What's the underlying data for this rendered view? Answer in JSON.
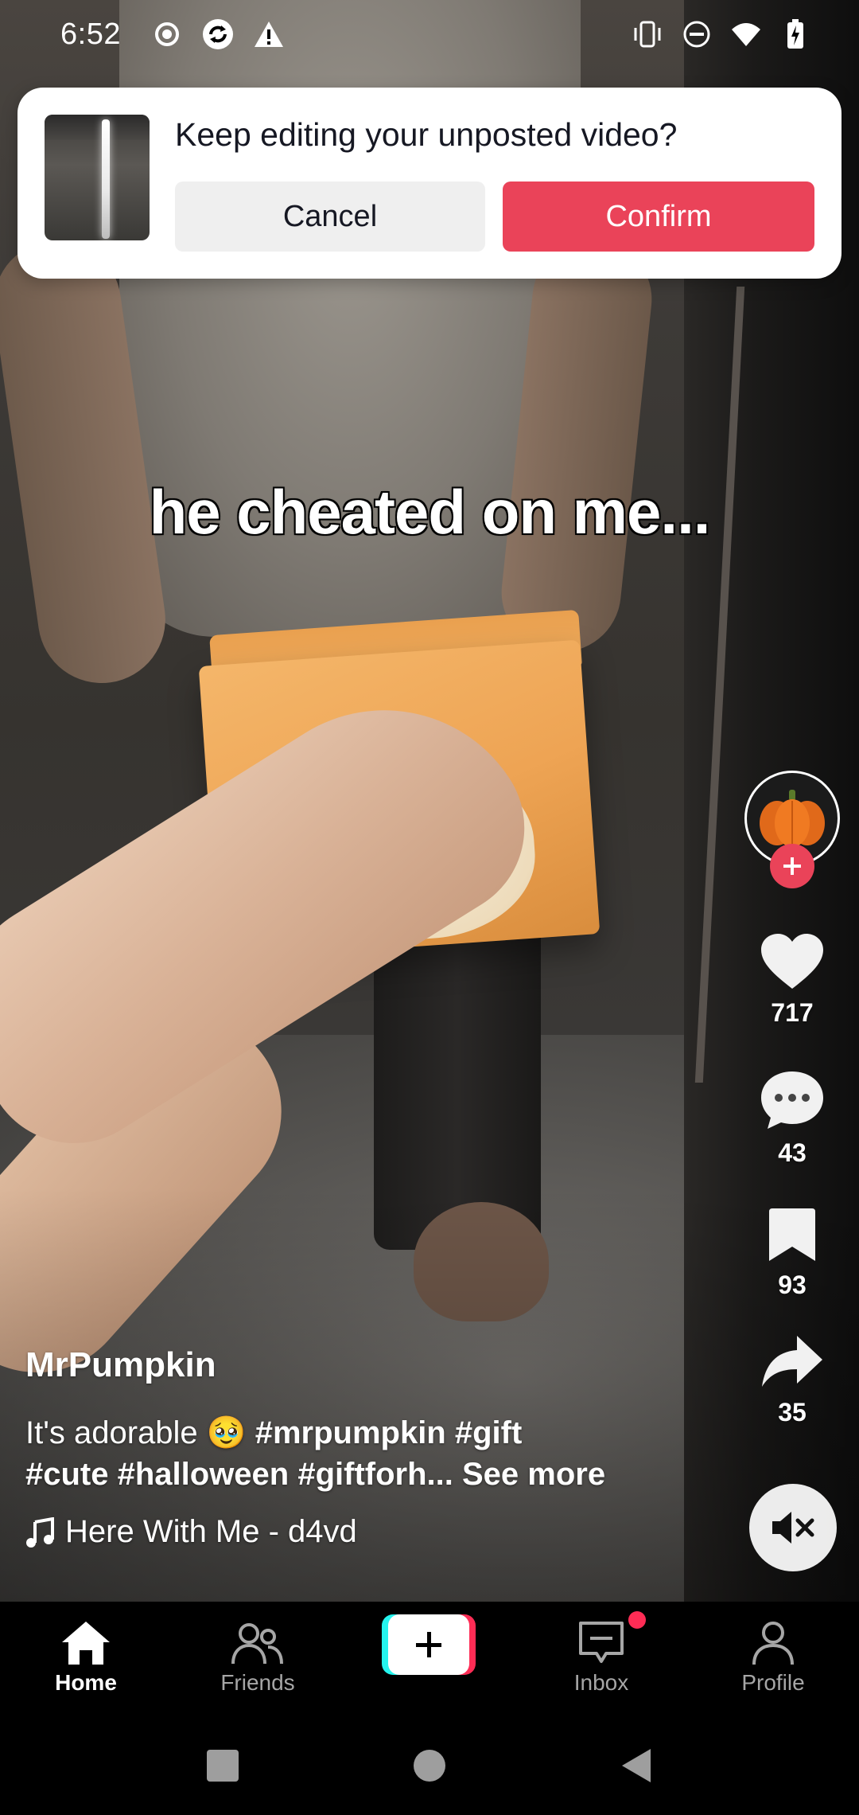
{
  "status_bar": {
    "time": "6:52",
    "left_icons": [
      "record-icon",
      "sync-app-icon",
      "warning-icon"
    ],
    "right_icons": [
      "vibrate-icon",
      "do-not-disturb-icon",
      "wifi-icon",
      "battery-charging-icon"
    ]
  },
  "draft_banner": {
    "title": "Keep editing your unposted video?",
    "cancel_label": "Cancel",
    "confirm_label": "Confirm",
    "confirm_color": "#ea4359"
  },
  "video": {
    "caption": "he cheated on me..."
  },
  "actions": {
    "likes": "717",
    "comments": "43",
    "saves": "93",
    "shares": "35"
  },
  "post": {
    "author": "MrPumpkin",
    "description_text": "It's adorable 🥹",
    "tags_line1": "#mrpumpkin #gift",
    "tags_line2": "#cute #halloween #giftforh...",
    "see_more": "See more",
    "music": "Here With Me - d4vd"
  },
  "bottom_nav": {
    "items": [
      {
        "label": "Home",
        "icon": "home-icon"
      },
      {
        "label": "Friends",
        "icon": "friends-icon"
      },
      {
        "label": "",
        "icon": "create-plus-icon"
      },
      {
        "label": "Inbox",
        "icon": "inbox-icon"
      },
      {
        "label": "Profile",
        "icon": "profile-icon"
      }
    ],
    "active": "Home"
  },
  "system_nav": [
    "recents-icon",
    "home-circle-icon",
    "back-icon"
  ]
}
